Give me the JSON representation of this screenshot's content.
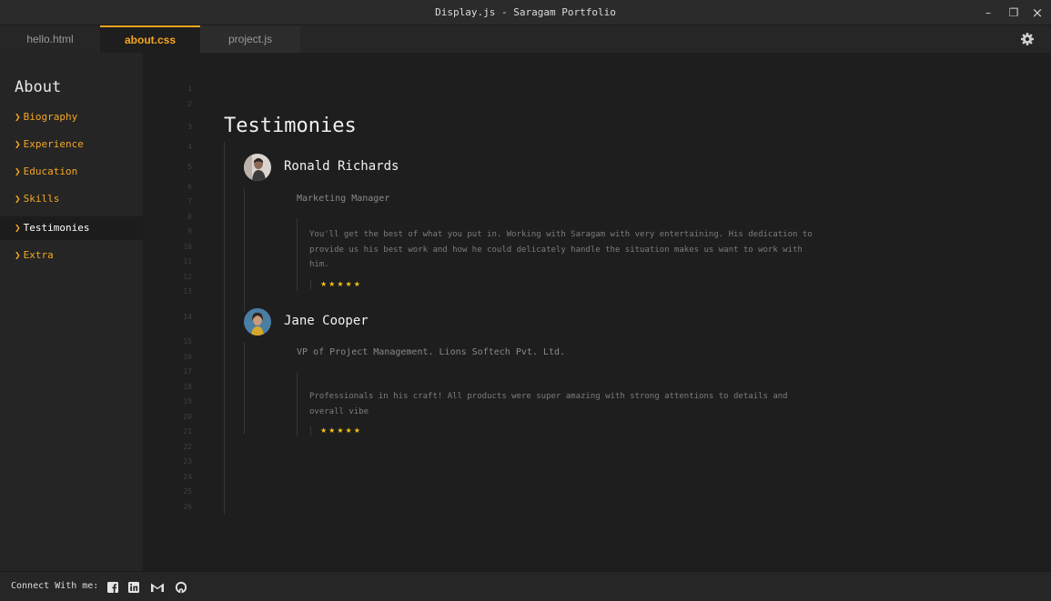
{
  "window": {
    "title": "Display.js - Saragam Portfolio",
    "minimize": "–",
    "restore": "❐",
    "close": "×"
  },
  "tabs": [
    {
      "label": "hello.html",
      "active": false
    },
    {
      "label": "about.css",
      "active": true
    },
    {
      "label": "project.js",
      "active": false
    }
  ],
  "sidebar": {
    "heading": "About",
    "items": [
      {
        "label": "Biography"
      },
      {
        "label": "Experience"
      },
      {
        "label": "Education"
      },
      {
        "label": "Skills"
      },
      {
        "label": "Testimonies"
      },
      {
        "label": "Extra"
      }
    ],
    "active_item": "Testimonies"
  },
  "editor": {
    "line_numbers": [
      "1",
      "2",
      "3",
      "4",
      "5",
      "6",
      "7",
      "8",
      "9",
      "10",
      "11",
      "12",
      "13",
      "14",
      "15",
      "16",
      "17",
      "18",
      "19",
      "20",
      "21",
      "22",
      "23",
      "24",
      "25",
      "26"
    ],
    "section_title": "Testimonies",
    "testimonies": [
      {
        "name": "Ronald Richards",
        "role": "Marketing Manager",
        "quote": "You'll get the best of what you put in. Working with Saragam with very entertaining. His dedication to provide us his best work and how he could delicately handle the situation makes us want to work with him.",
        "rating": 5,
        "stars": "★★★★★"
      },
      {
        "name": "Jane Cooper",
        "role": "VP of Project Management.  Lions Softech Pvt. Ltd.",
        "quote": "Professionals in his craft! All products were super amazing with strong attentions to details and overall vibe",
        "rating": 5,
        "stars": "★★★★★"
      }
    ]
  },
  "footer": {
    "label": "Connect With me:",
    "icons": [
      "facebook-icon",
      "linkedin-icon",
      "gmail-icon",
      "github-icon"
    ]
  },
  "colors": {
    "accent": "#f5a623",
    "star": "#f5c518",
    "background": "#1e1e1e",
    "sidebar": "#252525"
  }
}
